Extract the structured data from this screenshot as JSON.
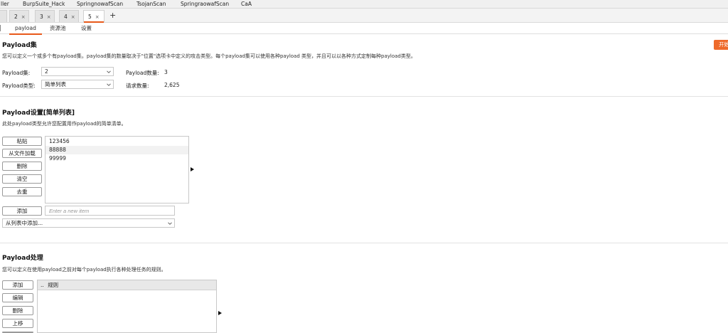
{
  "extension_tabs": [
    "ller",
    "BurpSuite_Hack",
    "SpringnowafScan",
    "TsojanScan",
    "SpringraowafScan",
    "CaA"
  ],
  "request_tabs": [
    {
      "label": "2",
      "close": "×"
    },
    {
      "label": "3",
      "close": "×"
    },
    {
      "label": "4",
      "close": "×"
    },
    {
      "label": "5",
      "close": "×"
    }
  ],
  "add_tab_label": "+",
  "sub_tabs": [
    "payload",
    "资源池",
    "设置"
  ],
  "payload_sets": {
    "title": "Payload集",
    "description": "您可以定义一个或多个有payload集。payload集的数量取决于\"位置\"选项卡中定义的攻击类型。每个payload集可以使用各种payload 类型，并且可以以各种方式定制每种payload类型。",
    "set_label": "Payload集:",
    "set_value": "2",
    "type_label": "Payload类型:",
    "type_value": "简单列表",
    "count_label": "Payload数量:",
    "count_value": "3",
    "request_label": "请求数量:",
    "request_value": "2,625",
    "start_button": "开始"
  },
  "payload_settings": {
    "title": "Payload设置[简单列表]",
    "description": "此处payload类型允许您配置用作payload的简单清单。",
    "buttons": [
      "粘贴",
      "从文件加载",
      "删除",
      "清空",
      "去重"
    ],
    "items": [
      "123456",
      "88888",
      "99999"
    ],
    "add_button": "添加",
    "new_item_placeholder": "Enter a new item",
    "add_from_list": "从列表中添加..."
  },
  "payload_processing": {
    "title": "Payload处理",
    "description": "您可以定义在使用payload之前对每个payload执行各种处理任务的规则。",
    "buttons": [
      "添加",
      "编辑",
      "删除",
      "上移"
    ],
    "column_prefix": "..",
    "column_header": "规则"
  }
}
